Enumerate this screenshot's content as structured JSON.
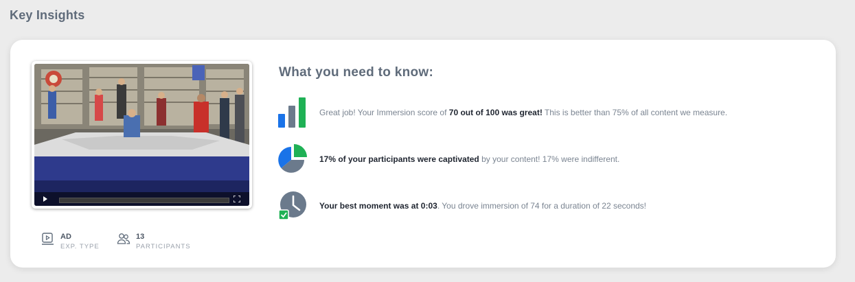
{
  "page": {
    "title": "Key Insights"
  },
  "video": {
    "progress": 0.0
  },
  "meta": {
    "exp_type": {
      "value": "AD",
      "label": "EXP. TYPE"
    },
    "participants": {
      "value": "13",
      "label": "PARTICIPANTS"
    }
  },
  "insights": {
    "heading": "What you need to know:",
    "score": {
      "pre": "Great job! Your Immersion score of ",
      "bold": "70 out of 100 was great!",
      "post": " This is better than 75% of all content we measure.",
      "icon": "bar-chart-icon"
    },
    "captivated": {
      "bold": "17% of your participants were captivated",
      "post": " by your content! 17% were indifferent.",
      "icon": "pie-chart-icon"
    },
    "moment": {
      "bold": "Your best moment was at 0:03",
      "post": ". You drove immersion of 74 for a duration of 22 seconds!",
      "icon": "clock-check-icon"
    }
  },
  "colors": {
    "blue": "#1a73e8",
    "green": "#1fb155",
    "gray": "#6b7a8c"
  }
}
